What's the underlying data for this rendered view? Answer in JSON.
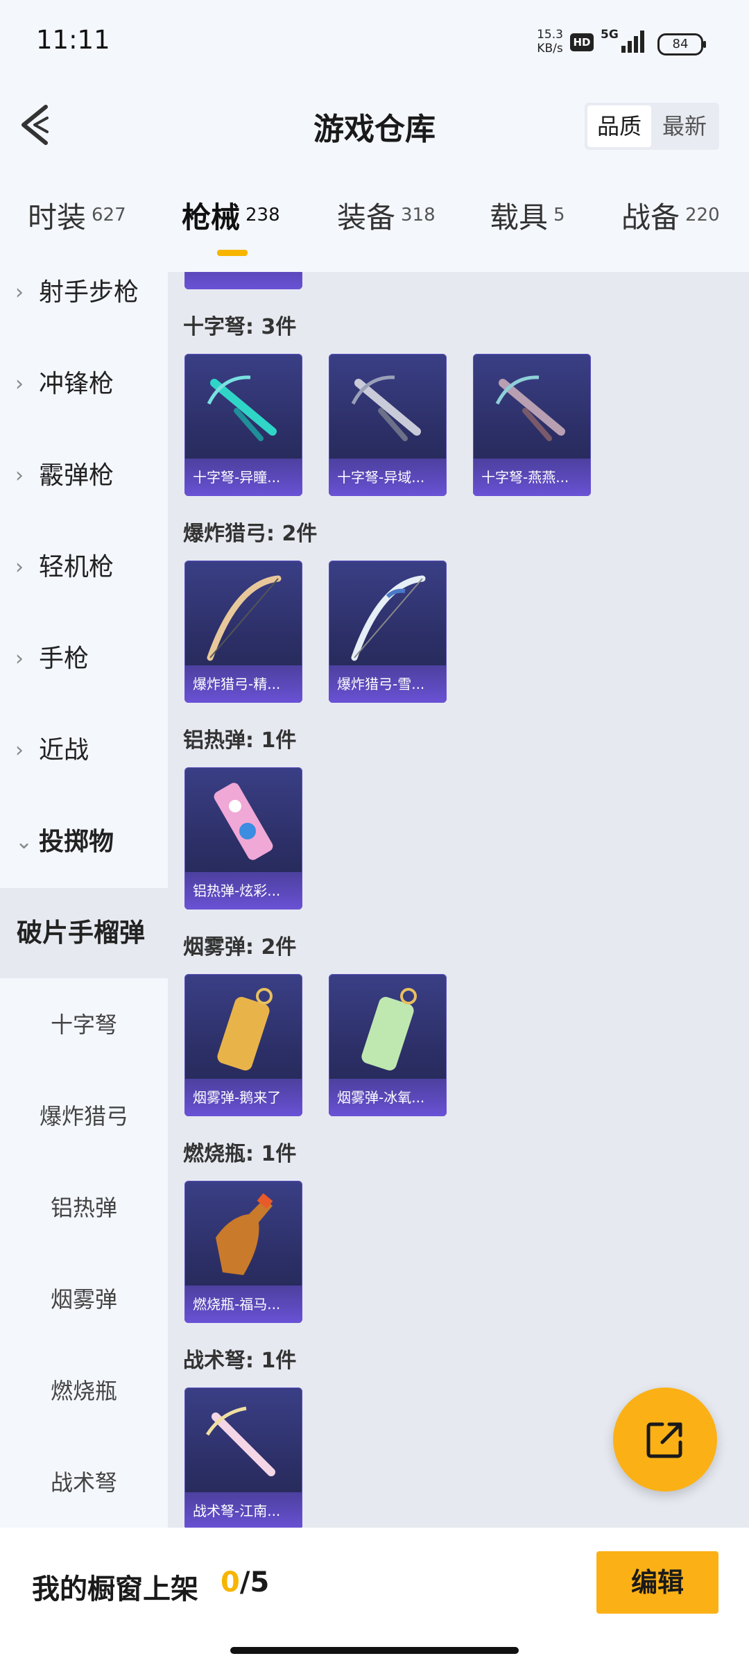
{
  "status_bar": {
    "time": "11:11",
    "net_speed_value": "15.3",
    "net_speed_unit": "KB/s",
    "hd_badge": "HD",
    "network": "5G",
    "battery": "84"
  },
  "header": {
    "title": "游戏仓库",
    "sort_options": [
      "品质",
      "最新"
    ],
    "sort_selected": "品质"
  },
  "category_tabs": [
    {
      "label": "时装",
      "count": "627",
      "active": false
    },
    {
      "label": "枪械",
      "count": "238",
      "active": true
    },
    {
      "label": "装备",
      "count": "318",
      "active": false
    },
    {
      "label": "载具",
      "count": "5",
      "active": false
    },
    {
      "label": "战备",
      "count": "220",
      "active": false
    }
  ],
  "sidebar": {
    "items": [
      {
        "label": "射手步枪",
        "chevron": "›"
      },
      {
        "label": "冲锋枪",
        "chevron": "›"
      },
      {
        "label": "霰弹枪",
        "chevron": "›"
      },
      {
        "label": "轻机枪",
        "chevron": "›"
      },
      {
        "label": "手枪",
        "chevron": "›"
      },
      {
        "label": "近战",
        "chevron": "›"
      },
      {
        "label": "投掷物",
        "chevron": "⌄"
      },
      {
        "label": "破片手榴弹"
      },
      {
        "label": "十字弩"
      },
      {
        "label": "爆炸猎弓"
      },
      {
        "label": "铝热弹"
      },
      {
        "label": "烟雾弹"
      },
      {
        "label": "燃烧瓶"
      },
      {
        "label": "战术弩"
      }
    ]
  },
  "sections": [
    {
      "title": "十字弩: 3件",
      "items": [
        "十字弩-异瞳...",
        "十字弩-异域...",
        "十字弩-燕燕..."
      ]
    },
    {
      "title": "爆炸猎弓: 2件",
      "items": [
        "爆炸猎弓-精...",
        "爆炸猎弓-雪..."
      ]
    },
    {
      "title": "铝热弹: 1件",
      "items": [
        "铝热弹-炫彩..."
      ]
    },
    {
      "title": "烟雾弹: 2件",
      "items": [
        "烟雾弹-鹅来了",
        "烟雾弹-冰氧..."
      ]
    },
    {
      "title": "燃烧瓶: 1件",
      "items": [
        "燃烧瓶-福马..."
      ]
    },
    {
      "title": "战术弩: 1件",
      "items": [
        "战术弩-江南..."
      ]
    }
  ],
  "bottom_bar": {
    "shelf_label": "我的橱窗上架",
    "shelf_used": "0",
    "shelf_total": "/5",
    "edit_label": "编辑"
  },
  "colors": {
    "accent": "#f7b500",
    "card_bg": "#2c2f66",
    "card_caption": "#6a52d6",
    "content_bg": "#e6e9f0"
  }
}
